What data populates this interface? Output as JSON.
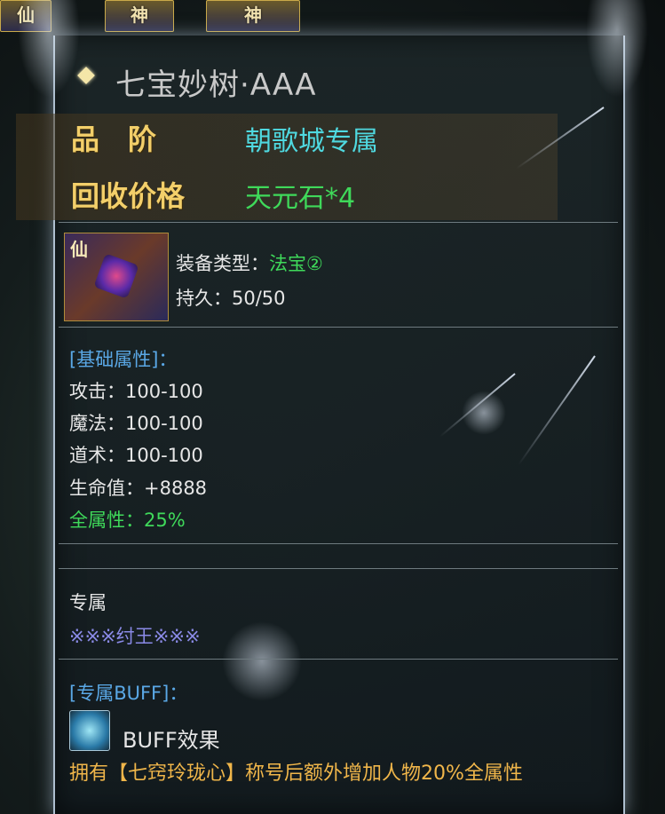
{
  "top_tiles": [
    {
      "label": "仙"
    },
    {
      "label": "神"
    },
    {
      "label": "神"
    }
  ],
  "item": {
    "name": "七宝妙树·AAA",
    "grade_label": "品　阶",
    "grade_value": "朝歌城专属",
    "recycle_label": "回收价格",
    "recycle_value": "天元石*4",
    "icon_label": "仙",
    "type_label": "装备类型：",
    "type_value": "法宝②",
    "durability": "持久：50/50"
  },
  "base_attrs": {
    "header": "[基础属性]：",
    "rows": [
      {
        "text": "攻击：100-100"
      },
      {
        "text": "魔法：100-100"
      },
      {
        "text": "道术：100-100"
      },
      {
        "text": "生命值：+8888"
      }
    ],
    "all_attr": "全属性：25%"
  },
  "exclusive": {
    "header": "专属",
    "owner": "※※※纣王※※※"
  },
  "buff": {
    "header": "[专属BUFF]：",
    "name": "BUFF效果",
    "desc": "拥有【七窍玲珑心】称号后额外增加人物20%全属性"
  },
  "colors": {
    "grade": "#4fd9e0",
    "recycle": "#3fd95a",
    "label_gold": "#f3cf6a",
    "attr_header_blue": "#5aa8e6",
    "owner_purple": "#8a8ae6",
    "buff_desc_gold": "#f0b64a"
  }
}
